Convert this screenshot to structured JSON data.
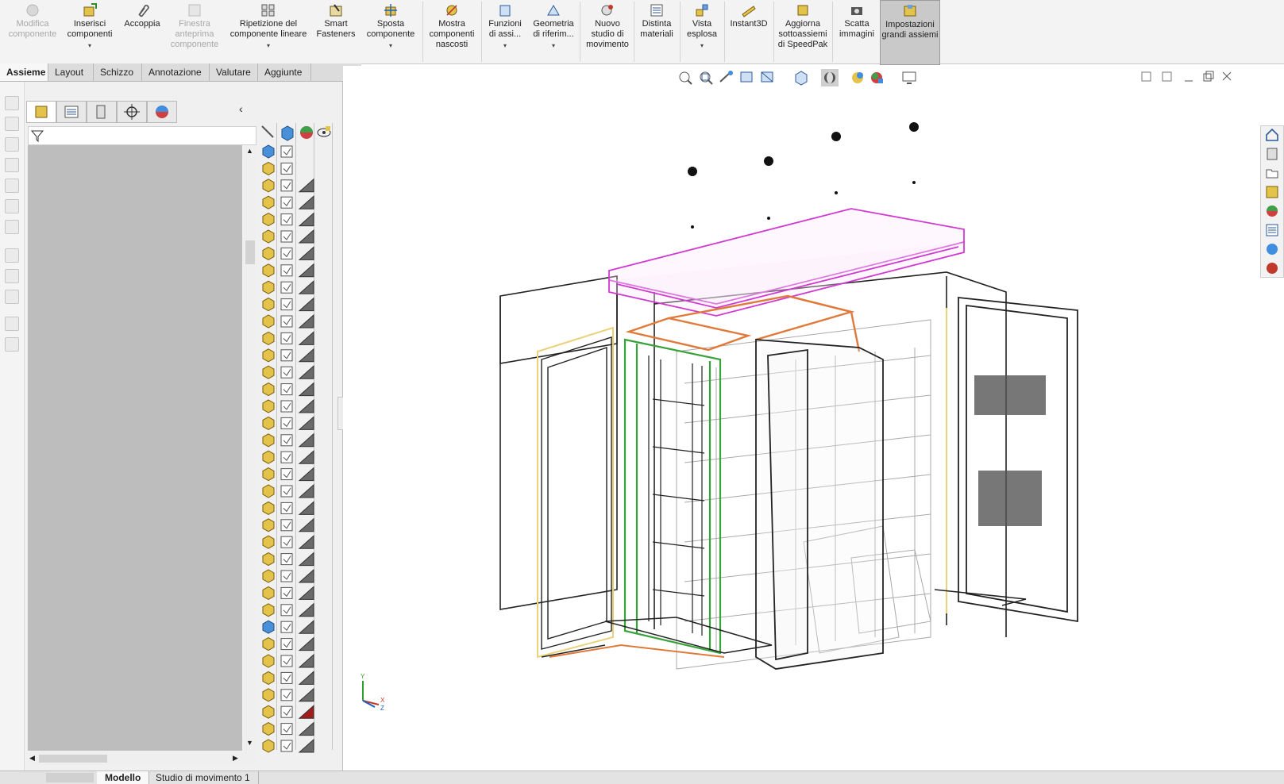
{
  "ribbon": {
    "buttons": [
      {
        "name": "modifica-componente-button",
        "label": "Modifica componente",
        "disabled": true
      },
      {
        "name": "inserisci-componenti-button",
        "label": "Inserisci componenti",
        "dropdown": true
      },
      {
        "name": "accoppia-button",
        "label": "Accoppia"
      },
      {
        "name": "finestra-anteprima-button",
        "label": "Finestra anteprima componente",
        "disabled": true
      },
      {
        "name": "ripetizione-lineare-button",
        "label": "Ripetizione del componente lineare",
        "dropdown": true
      },
      {
        "name": "smart-fasteners-button",
        "label": "Smart Fasteners"
      },
      {
        "name": "sposta-componente-button",
        "label": "Sposta componente",
        "dropdown": true
      },
      {
        "name": "mostra-nascosti-button",
        "label": "Mostra componenti nascosti"
      },
      {
        "name": "funzioni-assieme-button",
        "label": "Funzioni di assi...",
        "dropdown": true
      },
      {
        "name": "geometria-riferimento-button",
        "label": "Geometria di riferim...",
        "dropdown": true
      },
      {
        "name": "nuovo-studio-movimento-button",
        "label": "Nuovo studio di movimento"
      },
      {
        "name": "distinta-materiali-button",
        "label": "Distinta materiali"
      },
      {
        "name": "vista-esplosa-button",
        "label": "Vista esplosa",
        "dropdown": true
      },
      {
        "name": "instant3d-button",
        "label": "Instant3D"
      },
      {
        "name": "aggiorna-speedpak-button",
        "label": "Aggiorna sottoassiemi di SpeedPak"
      },
      {
        "name": "scatta-immagini-button",
        "label": "Scatta immagini"
      },
      {
        "name": "impostazioni-grandi-assiemi-button",
        "label": "Impostazioni grandi assiemi",
        "active": true
      }
    ]
  },
  "tabs": [
    "Assieme",
    "Layout",
    "Schizzo",
    "Annotazione",
    "Valutare",
    "Aggiunte"
  ],
  "bottom_tabs": [
    "Modello",
    "Studio di movimento 1"
  ],
  "colors": {
    "purple": "#d13ad1",
    "orange": "#e07a3a",
    "green": "#3aa23a",
    "yellow": "#e9d27a",
    "tree_bg": "#bdbdbd",
    "ribbon_bg": "#f3f3f3"
  },
  "triad": {
    "y": "Y",
    "x": "X",
    "z": "Z"
  }
}
